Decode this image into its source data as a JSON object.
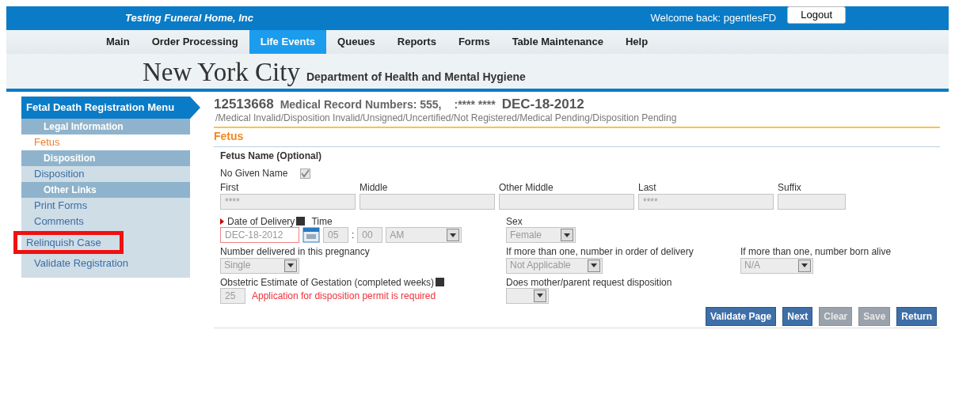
{
  "header": {
    "company": "Testing Funeral Home, Inc",
    "welcome": "Welcome back: pgentlesFD",
    "logout": "Logout"
  },
  "nav": [
    {
      "label": "Main",
      "selected": false
    },
    {
      "label": "Order Processing",
      "selected": false
    },
    {
      "label": "Life Events",
      "selected": true
    },
    {
      "label": "Queues",
      "selected": false
    },
    {
      "label": "Reports",
      "selected": false
    },
    {
      "label": "Forms",
      "selected": false
    },
    {
      "label": "Table Maintenance",
      "selected": false
    },
    {
      "label": "Help",
      "selected": false
    }
  ],
  "banner": {
    "city": "New York City",
    "department": "Department of Health and Mental Hygiene"
  },
  "sidebar": {
    "title": "Fetal Death Registration Menu",
    "items": [
      {
        "kind": "section",
        "label": "Legal Information"
      },
      {
        "kind": "link",
        "label": "Fetus",
        "selected": true,
        "highlighted": false
      },
      {
        "kind": "section",
        "label": "Disposition"
      },
      {
        "kind": "link",
        "label": "Disposition",
        "selected": false,
        "highlighted": false
      },
      {
        "kind": "section",
        "label": "Other Links"
      },
      {
        "kind": "link",
        "label": "Print Forms",
        "selected": false,
        "highlighted": false
      },
      {
        "kind": "link",
        "label": "Comments",
        "selected": false,
        "highlighted": false
      },
      {
        "kind": "link",
        "label": "Relinquish Case",
        "selected": false,
        "highlighted": true
      },
      {
        "kind": "link",
        "label": "Validate Registration",
        "selected": false,
        "highlighted": false
      }
    ]
  },
  "case": {
    "number": "12513668",
    "records": "Medical Record Numbers: 555,",
    "name": ":**** ****",
    "date": "DEC-18-2012",
    "status": "/Medical Invalid/Disposition Invalid/Unsigned/Uncertified/Not Registered/Medical Pending/Disposition Pending"
  },
  "section_title": "Fetus",
  "form": {
    "group_label": "Fetus Name (Optional)",
    "no_given_name": {
      "label": "No Given Name",
      "checked": true
    },
    "name_fields": [
      {
        "label": "First",
        "value": "****"
      },
      {
        "label": "Middle"
      },
      {
        "label": "Other Middle"
      },
      {
        "label": "Last",
        "value": "****"
      },
      {
        "label": "Suffix"
      }
    ],
    "delivery": {
      "label": "Date of Delivery",
      "required": true,
      "date": "DEC-18-2012",
      "invalid": true,
      "time_label": "Time",
      "hour": "05",
      "separator": ":",
      "minute": "00",
      "ampm": "AM"
    },
    "sex": {
      "label": "Sex",
      "value": "Female"
    },
    "number_delivered": {
      "label": "Number delivered in this pregnancy",
      "value": "Single"
    },
    "order_of_delivery": {
      "label": "If more than one, number in order of delivery",
      "value": "Not Applicable"
    },
    "born_alive": {
      "label": "If more than one, number born alive",
      "value": "N/A"
    },
    "gestation": {
      "label": "Obstetric Estimate of Gestation (completed weeks)",
      "value": "25",
      "error": "Application for disposition permit is required"
    },
    "disposition_request": {
      "label": "Does mother/parent request disposition"
    }
  },
  "buttons": [
    {
      "label": "Validate Page",
      "disabled": false
    },
    {
      "label": "Next",
      "disabled": false
    },
    {
      "label": "Clear",
      "disabled": true
    },
    {
      "label": "Save",
      "disabled": true
    },
    {
      "label": "Return",
      "disabled": false
    }
  ]
}
